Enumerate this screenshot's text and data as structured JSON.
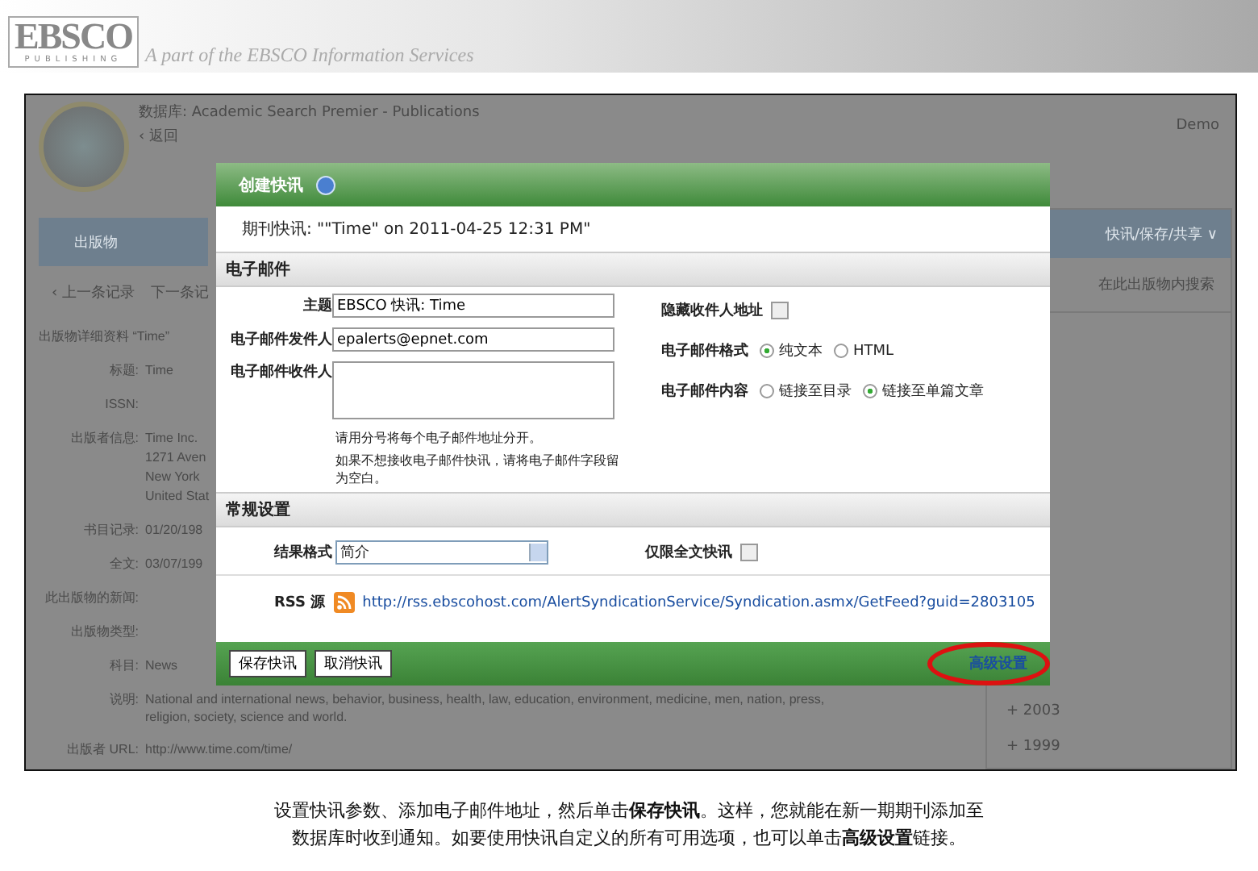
{
  "header": {
    "logo": "EBSCO",
    "logo_sub": "PUBLISHING",
    "tagline": "A part of the EBSCO Information Services"
  },
  "page": {
    "database_line": "数据库: Academic Search Premier - Publications",
    "back_link": "‹ 返回",
    "user_link": "Demo",
    "tab": "出版物",
    "menu": "快讯/保存/共享 ∨",
    "prev_link": "‹ 上一条记录",
    "next_link": "下一条记",
    "search_link": "在此出版物内搜索",
    "details_title": "出版物详细资料 “Time”",
    "fields": [
      {
        "label": "标题:",
        "values": [
          "Time"
        ]
      },
      {
        "label": "ISSN:"
      },
      {
        "label": "出版者信息:",
        "values": [
          "Time Inc.",
          "1271 Aven",
          "New York",
          "United Stat"
        ]
      },
      {
        "label": "书目记录:",
        "values": [
          "01/20/198"
        ]
      },
      {
        "label": "全文:",
        "values": [
          "03/07/199"
        ]
      },
      {
        "label": "此出版物的新闻:"
      },
      {
        "label": "出版物类型:"
      },
      {
        "label": "科目:",
        "values": [
          "News"
        ]
      },
      {
        "label": "说明:",
        "values": [
          "National and international news, behavior, business, health, law, education, environment, medicine, men, nation, press,",
          "religion, society, science and world."
        ]
      },
      {
        "label": "出版者 URL:",
        "values": [
          "http://www.time.com/time/"
        ]
      }
    ],
    "years": [
      "+ 2003",
      "+ 1999"
    ]
  },
  "dialog": {
    "title": "创建快讯",
    "alert_name": "期刊快讯: \"\"Time\" on 2011-04-25 12:31 PM\"",
    "email_section": "电子邮件",
    "subject": {
      "label": "主题",
      "value": "EBSCO 快讯: Time"
    },
    "sender": {
      "label": "电子邮件发件人",
      "value": "epalerts@epnet.com"
    },
    "recipients": {
      "label": "电子邮件收件人"
    },
    "hints": [
      "请用分号将每个电子邮件地址分开。",
      "如果不想接收电子邮件快讯，请将电子邮件字段留为空白。"
    ],
    "hide_recipients": {
      "label": "隐藏收件人地址",
      "checked": false
    },
    "format": {
      "label": "电子邮件格式",
      "options": [
        {
          "label": "纯文本",
          "selected": true
        },
        {
          "label": "HTML",
          "selected": false
        }
      ]
    },
    "content": {
      "label": "电子邮件内容",
      "options": [
        {
          "label": "链接至目录",
          "selected": false
        },
        {
          "label": "链接至单篇文章",
          "selected": true
        }
      ]
    },
    "general_section": "常规设置",
    "result_format": {
      "label": "结果格式",
      "value": "简介"
    },
    "fulltext_only": {
      "label": "仅限全文快讯",
      "checked": false
    },
    "rss": {
      "label": "RSS 源",
      "url": "http://rss.ebscohost.com/AlertSyndicationService/Syndication.asmx/GetFeed?guid=2803105"
    },
    "buttons": [
      "保存快讯",
      "取消快讯"
    ],
    "advanced_link": "高级设置"
  },
  "caption": [
    "设置快讯参数、添加电子邮件地址，然后单击**保存快讯**。这样，您就能在新一期期刊添加至",
    "数据库时收到通知。如要使用快讯自定义的所有可用选项，也可以单击**高级设置**链接。"
  ]
}
